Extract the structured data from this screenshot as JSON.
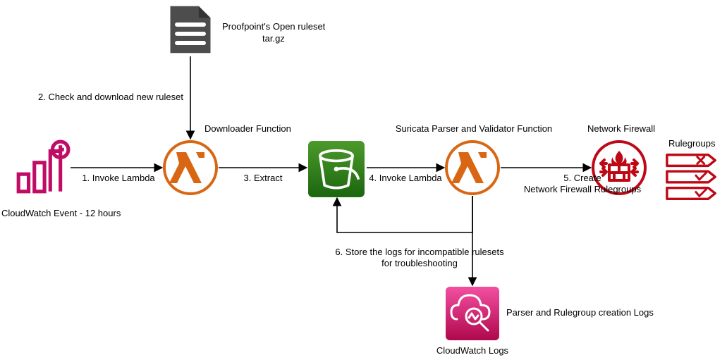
{
  "nodes": {
    "cloudwatch_event": {
      "label": "CloudWatch Event - 12 hours"
    },
    "ruleset_file": {
      "title": "Proofpoint's Open ruleset",
      "subtitle": "tar.gz"
    },
    "downloader": {
      "label": "Downloader Function"
    },
    "parser": {
      "label": "Suricata Parser and Validator Function"
    },
    "firewall": {
      "label": "Network Firewall"
    },
    "rulegroups": {
      "label": "Rulegroups"
    },
    "cw_logs": {
      "label": "CloudWatch Logs",
      "side": "Parser and Rulegroup creation Logs"
    }
  },
  "edges": {
    "e1": "1. Invoke Lambda",
    "e2": "2. Check and download new ruleset",
    "e3": "3. Extract",
    "e4": "4. Invoke Lambda",
    "e5": "5. Create\nNetwork Firewall Rulegroups",
    "e6": "6. Store the logs for incompatible rulesets\nfor troubleshooting"
  },
  "colors": {
    "magenta": "#bf0d66",
    "orange": "#d86613",
    "green": "#3f8624",
    "darkgreen": "#1b660f",
    "red": "#bf0816",
    "pink": "#e7157b",
    "dark": "#4d4d4d"
  }
}
